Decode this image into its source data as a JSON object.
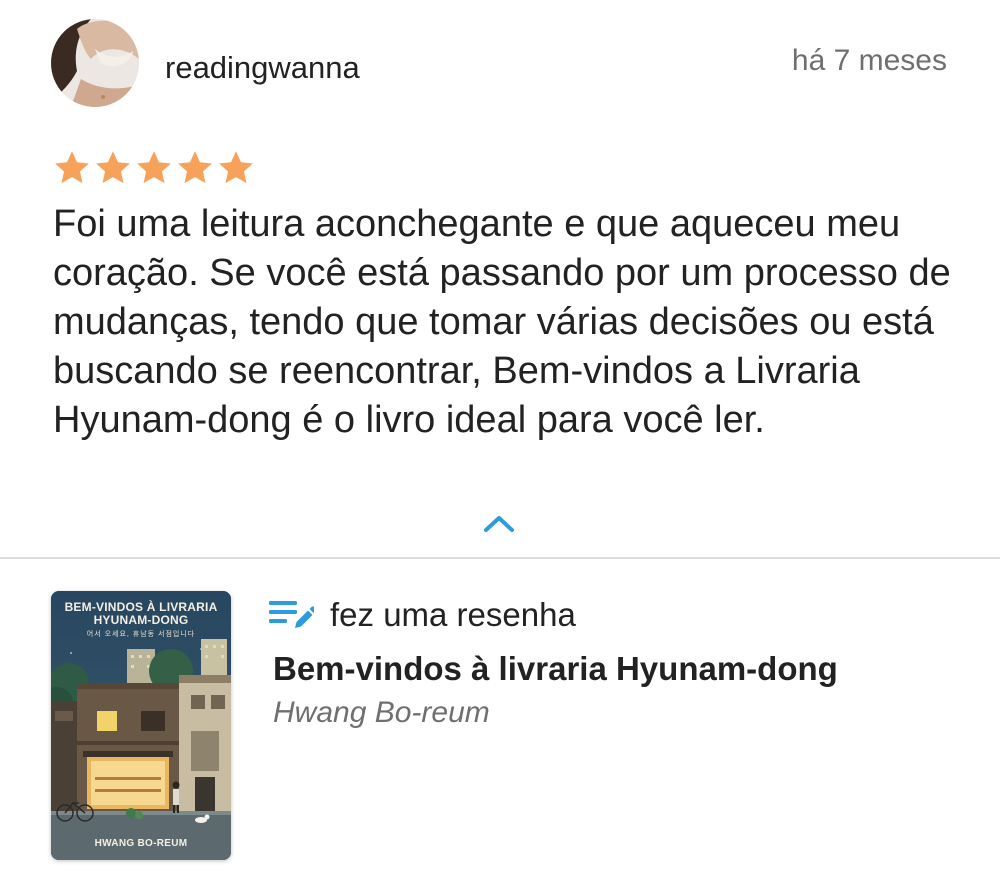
{
  "review": {
    "username": "readingwanna",
    "timestamp": "há 7 meses",
    "rating": 5,
    "rating_max": 5,
    "text": "Foi uma leitura aconchegante e que aqueceu meu coração. Se você está passando por um processo de mudanças, tendo que tomar várias decisões ou está buscando se reencontrar, Bem-vindos a Livraria Hyunam-dong é o livro ideal para você ler."
  },
  "colors": {
    "star": "#F7A25B",
    "accent_blue": "#2E9BDE",
    "muted_text": "#6F6F6F",
    "divider": "#DDDDDD"
  },
  "icons": {
    "collapse": "chevron-up-icon",
    "action": "edit-list-icon",
    "star": "star-icon"
  },
  "book": {
    "action_label": "fez uma resenha",
    "title": "Bem-vindos à livraria Hyunam-dong",
    "author": "Hwang Bo-reum",
    "cover": {
      "title": "BEM-VINDOS À LIVRARIA HYUNAM-DONG",
      "subtitle_korean": "어서 오세요, 휴남동 서점입니다",
      "author": "HWANG BO-REUM"
    }
  }
}
